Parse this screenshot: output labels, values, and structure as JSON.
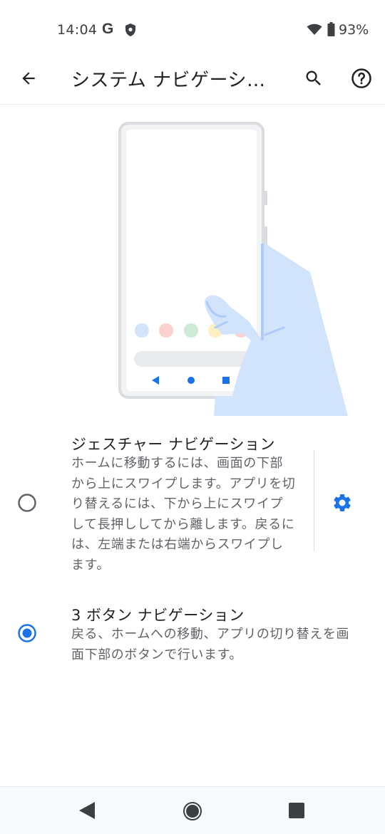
{
  "status": {
    "time": "14:04",
    "g_label": "G",
    "battery": "93%"
  },
  "app_bar": {
    "title": "システム ナビゲーシ…"
  },
  "options": [
    {
      "title": "ジェスチャー ナビゲーション",
      "lines": [
        "ホームに移動するには、画面の下部",
        "から上にスワイプします。アプリを切",
        "り替えるには、下から上にスワイプ",
        "して長押ししてから離します。戻るに",
        "は、左端または右端からスワイプし",
        "ます。"
      ],
      "selected": false
    },
    {
      "title": "3 ボタン ナビゲーション",
      "lines": [
        "戻る、ホームへの移動、アプリの切り替えを画",
        "面下部のボタンで行います。"
      ],
      "selected": true
    }
  ],
  "colors": {
    "accent": "#1a73e8",
    "hand": "#d2e3fc",
    "phone_frame": "#e8eaed"
  },
  "icons": [
    "back-arrow-icon",
    "search-icon",
    "help-icon",
    "gear-icon",
    "nav-back-icon",
    "nav-home-icon",
    "nav-recents-icon"
  ]
}
